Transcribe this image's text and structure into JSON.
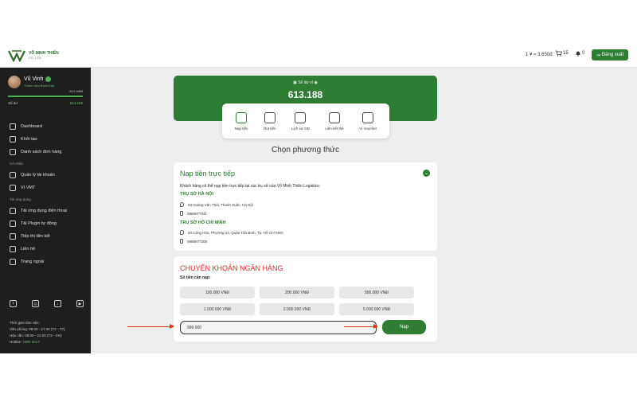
{
  "brand": {
    "name": "VÕ MINH THIÊN",
    "sub": "CO.,LTD."
  },
  "header": {
    "rate": "1 ¥ = 3.650đ",
    "cart_count": "15",
    "notif_count": "0",
    "logout_label": "Đăng xuất"
  },
  "sidebar": {
    "user": {
      "name": "Vũ Vinh",
      "rank": "Thành viên Bạch Kim",
      "progress_value": "613.188đ",
      "balance_label": "Số dư",
      "balance_value": "613.188"
    },
    "items": [
      {
        "type": "item",
        "label": "Dashboard",
        "icon": "grid-icon"
      },
      {
        "type": "item",
        "label": "Khởi tạo",
        "icon": "create-icon"
      },
      {
        "type": "item",
        "label": "Danh sách đơn hàng",
        "icon": "orders-icon"
      },
      {
        "type": "section",
        "label": "Cá nhân"
      },
      {
        "type": "item",
        "label": "Quản lý tài khoản",
        "icon": "user-icon"
      },
      {
        "type": "item",
        "label": "Ví VMT",
        "icon": "wallet-icon"
      },
      {
        "type": "section",
        "label": "Tải ứng dụng"
      },
      {
        "type": "item",
        "label": "Tải ứng dụng điện thoại",
        "icon": "phone-icon"
      },
      {
        "type": "item",
        "label": "Tải Plugin tự động",
        "icon": "plugin-icon"
      },
      {
        "type": "item",
        "label": "Tiếp thị liên kết",
        "icon": "affiliate-icon"
      },
      {
        "type": "item",
        "label": "Liên hệ",
        "icon": "contact-icon"
      },
      {
        "type": "item",
        "label": "Trang ngoài",
        "icon": "external-icon"
      }
    ],
    "socials": [
      "f",
      "◎",
      "♪",
      "▶"
    ],
    "worktime": {
      "title": "Thời gian làm việc:",
      "office": "Văn phòng: 08:00 - 17:30 (T2 - T7)",
      "support": "Hậu cần: 09:00 - 21:00 (T2 - CN)",
      "hotline_label": "Hotline: ",
      "hotline": "1900 3017"
    }
  },
  "wallet": {
    "label": "Số dư ví",
    "amount": "613.188"
  },
  "actions": [
    {
      "label": "Nạp tiền",
      "icon": "deposit-icon",
      "active": true
    },
    {
      "label": "Rút tiền",
      "icon": "withdraw-icon",
      "active": false
    },
    {
      "label": "Lịch sử GD",
      "icon": "history-icon",
      "active": false
    },
    {
      "label": "Liên kết thẻ",
      "icon": "card-link-icon",
      "active": false
    },
    {
      "label": "Ví Voucher",
      "icon": "voucher-icon",
      "active": false
    }
  ],
  "method_title": "Chọn phương thức",
  "direct": {
    "title": "Nạp tiền trực tiếp",
    "desc": "Khách hàng có thể nạp tiền trực tiếp tại các trụ sở của Võ Minh Thiên Logistics:",
    "branches": [
      {
        "name": "TRỤ SỞ HÀ NỘI",
        "address": "93 Hoàng Văn Thái, Thanh Xuân, Hà Nội",
        "phone": "0988977041"
      },
      {
        "name": "TRỤ SỞ HỒ CHÍ MINH",
        "address": "20 Cộng Hòa, Phường 12, Quận Tân Bình, Tp. Hồ Chí Minh",
        "phone": "0988977308"
      }
    ]
  },
  "bank": {
    "title": "CHUYỂN KHOẢN NGÂN HÀNG",
    "amount_label": "Số tiền cần nạp:",
    "options": [
      "100.000 VNĐ",
      "200.000 VNĐ",
      "500.000 VNĐ",
      "1.000.000 VNĐ",
      "2.000.000 VNĐ",
      "5.000.000 VNĐ"
    ],
    "input_value": "999.000",
    "submit_label": "Nạp"
  },
  "colors": {
    "primary": "#2e7d32",
    "danger": "#d32f2f",
    "sidebar": "#1e1e1e"
  }
}
